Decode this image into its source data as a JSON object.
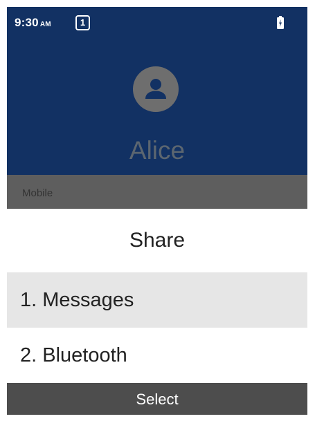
{
  "status_bar": {
    "time": "9:30",
    "ampm": "AM",
    "notification_count": "1",
    "battery_icon": "battery-charging-icon"
  },
  "contact": {
    "avatar_icon": "person-icon",
    "name": "Alice",
    "phone_type": "Mobile"
  },
  "share_dialog": {
    "title": "Share",
    "items": [
      {
        "label": "1. Messages",
        "focused": true
      },
      {
        "label": "2. Bluetooth",
        "focused": false
      }
    ]
  },
  "softkeys": {
    "center": "Select"
  },
  "colors": {
    "header_bg": "#123163",
    "focus_bg": "#e6e6e6",
    "softkey_bg": "#4d4d4d"
  }
}
